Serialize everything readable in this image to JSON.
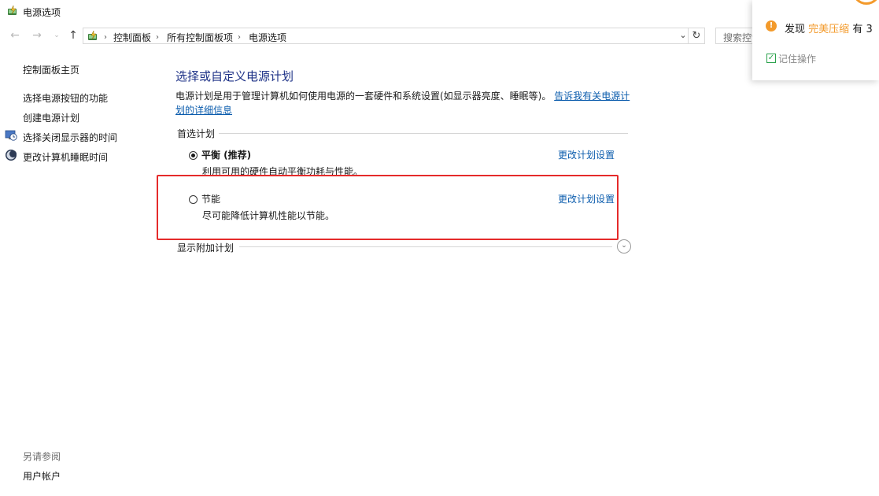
{
  "window": {
    "title": "电源选项",
    "icon": "power-options-icon"
  },
  "address_bar": {
    "crumbs": [
      "控制面板",
      "所有控制面板项",
      "电源选项"
    ],
    "search_placeholder": "搜索控制面板"
  },
  "sidebar": {
    "home_link": "控制面板主页",
    "links": [
      {
        "label": "选择电源按钮的功能",
        "icon": ""
      },
      {
        "label": "创建电源计划",
        "icon": ""
      },
      {
        "label": "选择关闭显示器的时间",
        "icon": "monitor-clock-icon"
      },
      {
        "label": "更改计算机睡眠时间",
        "icon": "moon-icon"
      }
    ],
    "see_also_header": "另请参阅",
    "see_also_links": [
      "用户帐户"
    ]
  },
  "main": {
    "title": "选择或自定义电源计划",
    "description": "电源计划是用于管理计算机如何使用电源的一套硬件和系统设置(如显示器亮度、睡眠等)。",
    "description_link": "告诉我有关电源计划的详细信息",
    "preferred_header": "首选计划",
    "plans": [
      {
        "name": "平衡 (推荐)",
        "description": "利用可用的硬件自动平衡功耗与性能。",
        "link": "更改计划设置",
        "selected": true
      },
      {
        "name": "节能",
        "description": "尽可能降低计算机性能以节能。",
        "link": "更改计划设置",
        "selected": false
      }
    ],
    "additional_header": "显示附加计划"
  },
  "popup": {
    "text_prefix": "发现",
    "text_accent": "完美压缩",
    "text_suffix": "有 3",
    "checkbox_label": "记住操作",
    "checkbox_checked": true,
    "accent_color": "#f39a2b"
  },
  "colors": {
    "highlight_border": "#e52b2b",
    "link": "#0b5cad",
    "title": "#1e3287"
  }
}
